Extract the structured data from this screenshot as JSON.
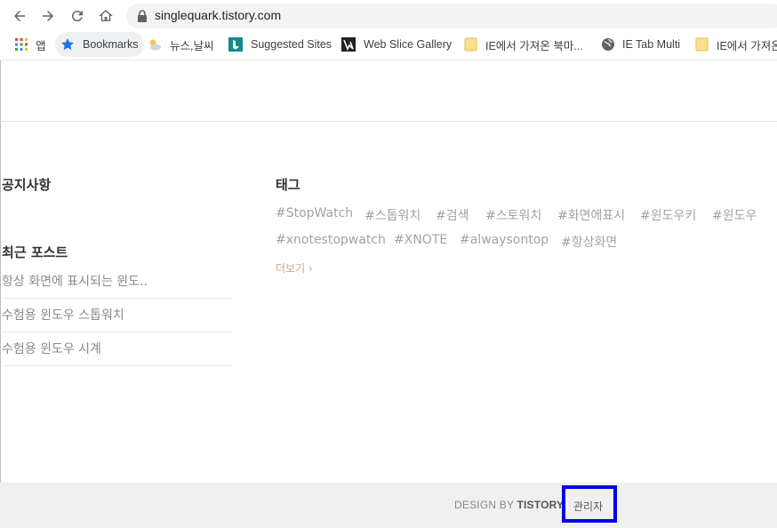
{
  "browser": {
    "url": "singlequark.tistory.com",
    "bookmarks": [
      {
        "label": "앱",
        "icon": "apps-grid-icon"
      },
      {
        "label": "Bookmarks",
        "icon": "star-icon"
      },
      {
        "label": "뉴스,날씨",
        "icon": "weather-icon"
      },
      {
        "label": "Suggested Sites",
        "icon": "bing-icon"
      },
      {
        "label": "Web Slice Gallery",
        "icon": "web-slice-icon"
      },
      {
        "label": "IE에서 가져온 북마...",
        "icon": "folder-icon"
      },
      {
        "label": "IE Tab Multi",
        "icon": "globe-icon"
      },
      {
        "label": "IE에서 가져온",
        "icon": "folder-icon"
      }
    ]
  },
  "sidebar": {
    "notice_title": "공지사항",
    "recent_title": "최근 포스트",
    "recent_posts": [
      "항상 화면에 표시되는 윈도..",
      "수험용 윈도우 스톱워치",
      "수험용 윈도우 시계"
    ]
  },
  "tags": {
    "title": "태그",
    "row1": [
      "#StopWatch",
      "#스톱워치",
      "#검색",
      "#스토워치",
      "#화면에표시",
      "#윈도우키",
      "#윈도우"
    ],
    "row2": [
      "#xnotestopwatch",
      "#XNOTE",
      "#alwaysontop",
      "#항상화면"
    ],
    "more": "더보기 ›"
  },
  "footer": {
    "design_by": "DESIGN BY",
    "brand": "TISTORY",
    "admin": "관리자"
  },
  "colors": {
    "highlight_border": "#0000e6",
    "tag_text": "#a3a3a3",
    "more_link": "#c9a98a"
  }
}
